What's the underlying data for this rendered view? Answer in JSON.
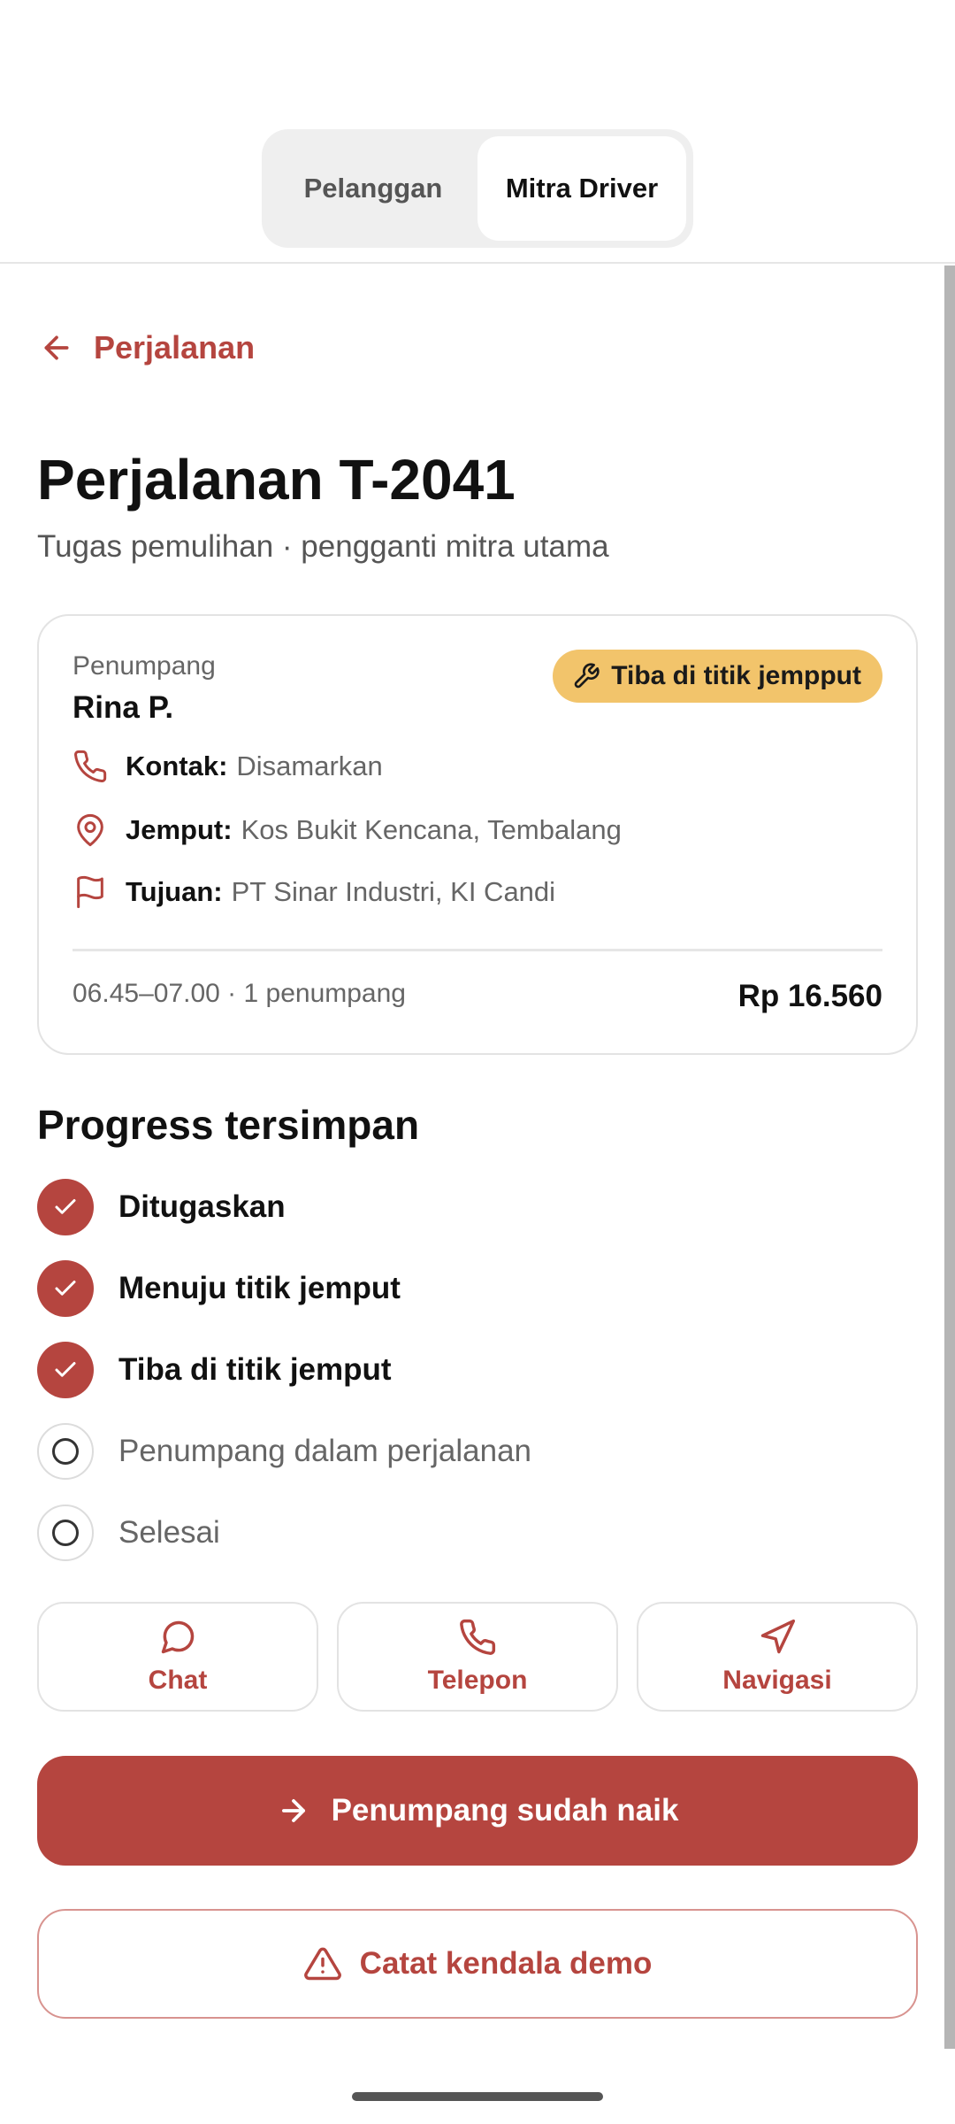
{
  "segment": {
    "options": [
      "Pelanggan",
      "Mitra Driver"
    ],
    "selected": "Mitra Driver"
  },
  "back_label": "Perjalanan",
  "trip": {
    "title": "Perjalanan T-2041",
    "subtitle": "Tugas pemulihan · pengganti mitra utama"
  },
  "card": {
    "passenger_label": "Penumpang",
    "passenger_name": "Rina P.",
    "status_badge": "Tiba di titik jempput",
    "contact_label": "Kontak:",
    "contact_value": "Disamarkan",
    "pickup_label": "Jemput:",
    "pickup_value": "Kos Bukit Kencana, Tembalang",
    "destination_label": "Tujuan:",
    "destination_value": "PT Sinar Industri, KI Candi",
    "schedule": "06.45–07.00 · 1 penumpang",
    "price": "Rp 16.560"
  },
  "progress": {
    "title": "Progress tersimpan",
    "steps": [
      {
        "label": "Ditugaskan",
        "done": true
      },
      {
        "label": "Menuju titik jemput",
        "done": true
      },
      {
        "label": "Tiba di titik jemput",
        "done": true
      },
      {
        "label": "Penumpang dalam perjalanan",
        "done": false
      },
      {
        "label": "Selesai",
        "done": false
      }
    ]
  },
  "actions": {
    "chat": "Chat",
    "phone": "Telepon",
    "navigation": "Navigasi"
  },
  "primary_button": "Penumpang sudah naik",
  "secondary_button": "Catat kendala demo",
  "colors": {
    "accent": "#b5453f",
    "badge": "#f2c46b",
    "border": "#e3e3e3"
  }
}
